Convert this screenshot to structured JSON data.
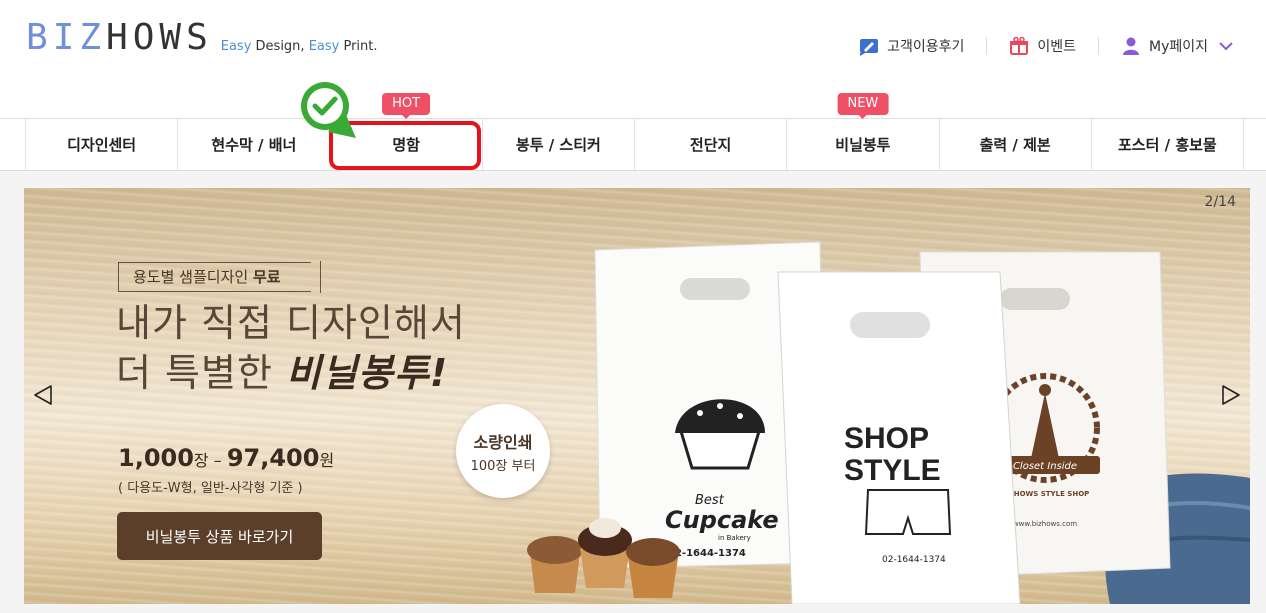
{
  "header": {
    "logo": {
      "part1": "B",
      "part2": "IZ",
      "part3": "HOWS"
    },
    "tagline": {
      "easy1": "Easy",
      "design": " Design, ",
      "easy2": "Easy",
      "print": " Print."
    },
    "util": {
      "reviews": "고객이용후기",
      "events": "이벤트",
      "mypage": "My페이지"
    }
  },
  "nav": {
    "items": [
      {
        "label": "디자인센터"
      },
      {
        "label": "현수막 / 배너"
      },
      {
        "label": "명함",
        "badge": "HOT"
      },
      {
        "label": "봉투 / 스티커"
      },
      {
        "label": "전단지"
      },
      {
        "label": "비닐봉투",
        "badge": "NEW"
      },
      {
        "label": "출력 / 제본"
      },
      {
        "label": "포스터 / 홍보물"
      }
    ]
  },
  "banner": {
    "counter": "2/14",
    "tag_text": "용도별 샘플디자인 ",
    "tag_bold": "무료",
    "headline_line1": "내가 직접 디자인해서",
    "headline_line2_pre": "더 특별한 ",
    "headline_line2_bold": "비닐봉투!",
    "price_qty": "1,000",
    "price_unit1": "장 – ",
    "price_amount": "97,400",
    "price_unit2": "원",
    "price_note": "( 다용도-W형, 일반-사각형 기준 )",
    "cta": "비닐봉투 상품 바로가기",
    "bubble_line1": "소량인쇄",
    "bubble_line2": "100장 부터",
    "bag1": {
      "brand_top": "Best",
      "brand_main": "Cupcake",
      "brand_sub": "in Bakery",
      "phone": "02-1644-1374"
    },
    "bag2": {
      "line1": "SHOP",
      "line2": "STYLE",
      "phone": "02-1644-1374"
    },
    "bag3": {
      "ribbon": "Closet Inside",
      "shop": "BIZHOWS STYLE SHOP",
      "url": "www.bizhows.com"
    }
  },
  "colors": {
    "accent_red": "#e4141c",
    "badge_pink": "#f05066",
    "cta_brown": "#5b3f2b",
    "check_green": "#3aa935"
  }
}
